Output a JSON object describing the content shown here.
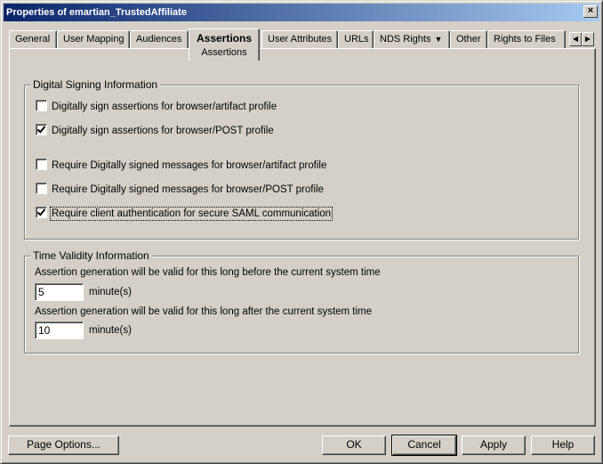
{
  "window": {
    "title": "Properties of emartian_TrustedAffiliate",
    "close_glyph": "×"
  },
  "tabs": [
    {
      "label": "General"
    },
    {
      "label": "User Mapping"
    },
    {
      "label": "Audiences"
    },
    {
      "label": "Assertions",
      "sub_label": "Assertions",
      "active": true
    },
    {
      "label": "User Attributes"
    },
    {
      "label": "URLs"
    },
    {
      "label": "NDS Rights"
    },
    {
      "label": "Other"
    },
    {
      "label": "Rights to Files"
    }
  ],
  "tab_scroll": {
    "left_glyph": "◀",
    "right_glyph": "▶"
  },
  "signing": {
    "title": "Digital Signing Information",
    "items": [
      {
        "label": "Digitally sign assertions for browser/artifact profile",
        "checked": false
      },
      {
        "label": "Digitally sign assertions for browser/POST profile",
        "checked": true
      },
      {
        "label": "Require Digitally signed messages for browser/artifact profile",
        "checked": false
      },
      {
        "label": "Require Digitally signed messages for browser/POST profile",
        "checked": false
      },
      {
        "label": "Require client authentication for secure SAML communication",
        "checked": true
      }
    ]
  },
  "validity": {
    "title": "Time Validity Information",
    "before_label": "Assertion generation will be valid for this long before the current system time",
    "before_value": "5",
    "after_label": "Assertion generation will be valid for this long after the current system time",
    "after_value": "10",
    "unit": "minute(s)"
  },
  "buttons": {
    "page_options": "Page Options...",
    "ok": "OK",
    "cancel": "Cancel",
    "apply": "Apply",
    "help": "Help"
  }
}
